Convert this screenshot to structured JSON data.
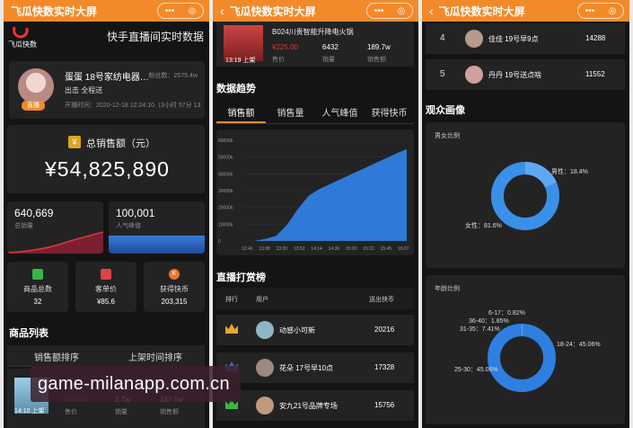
{
  "app": {
    "title": "飞瓜快数实时大屏"
  },
  "panel1": {
    "logo": "飞瓜快数",
    "heading": "快手直播间实时数据",
    "streamer": {
      "name": "蛋蛋 18号家纺电器…",
      "fans": "粉丝数：2575.4w",
      "tag": "出击 全程送",
      "start": "开播时间：2020-12-18 12:24:10（3小时 57分 13",
      "badge": "直播"
    },
    "gmv": {
      "label": "总销售额（元）",
      "value": "¥54,825,890",
      "icon": "yuan"
    },
    "sales": {
      "value": "640,669",
      "label": "总销量"
    },
    "popularity": {
      "value": "100,001",
      "label": "人气峰值"
    },
    "stats": [
      {
        "icon": "bag",
        "label": "商品总数",
        "value": "32"
      },
      {
        "icon": "tag",
        "label": "客单价",
        "value": "¥85.6"
      },
      {
        "icon": "coin",
        "label": "获得快币",
        "value": "203,315"
      }
    ],
    "products_title": "商品列表",
    "product_tabs": [
      "销售额排序",
      "上架时间排序"
    ],
    "product_row": {
      "time": "14:10 上架",
      "labels": [
        "售价",
        "销量",
        "销售额"
      ],
      "values": [
        "¥89.00",
        "2.7w",
        "237.1w"
      ]
    }
  },
  "panel2": {
    "product": {
      "name": "B024川贵智能升降电火锅",
      "time": "13:19 上架",
      "price": "¥225.00",
      "sales": "6432",
      "revenue": "189.7w",
      "labels": [
        "售价",
        "销量",
        "销售额"
      ]
    },
    "trend_title": "数据趋势",
    "trend_tabs": [
      "销售额",
      "销售量",
      "人气峰值",
      "获得快币"
    ],
    "chart_data": {
      "type": "area",
      "x": [
        "12:46",
        "13:08",
        "13:30",
        "13:52",
        "14:14",
        "14:36",
        "15:00",
        "15:22",
        "15:45",
        "16:07"
      ],
      "y_ticks": [
        "60000k",
        "50000k",
        "40000k",
        "30000k",
        "20000k",
        "10000k",
        "0"
      ],
      "ylim": [
        0,
        60000
      ],
      "points": [
        0,
        0,
        1200,
        3000,
        9500,
        19000,
        27000,
        31000,
        34000,
        37000,
        40000,
        43000,
        46000,
        49000,
        52000,
        54800
      ],
      "color": "#2f7fe0"
    },
    "ranking_title": "直播打赏榜",
    "ranking_headers": [
      "排行",
      "用户",
      "送出快币"
    ],
    "ranking": [
      {
        "rank": "1",
        "name": "动感小可新",
        "coins": "20216",
        "badge": "crown-gold"
      },
      {
        "rank": "2",
        "name": "花朵 17号早10点",
        "coins": "17328",
        "badge": "crown-silver"
      },
      {
        "rank": "3",
        "name": "安九21号品牌专场",
        "coins": "15756",
        "badge": "crown-bronze"
      }
    ]
  },
  "panel3": {
    "ranking": [
      {
        "rank": "4",
        "name": "佳佳 19号早9点",
        "coins": "14288"
      },
      {
        "rank": "5",
        "name": "丹丹 19号送点啥",
        "coins": "11552"
      }
    ],
    "audience_title": "观众画像",
    "gender": {
      "title": "男女比例",
      "male_label": "男性：18.4%",
      "female_label": "女性：81.6%",
      "male": 18.4,
      "female": 81.6
    },
    "age": {
      "title": "年龄比例",
      "labels": [
        "6-17：0.82%",
        "36-40：1.85%",
        "31-35：7.41%",
        "18-24：45.06%",
        "25-30：45.06%"
      ],
      "values": [
        0.82,
        1.85,
        7.41,
        45.06,
        45.06
      ]
    }
  },
  "watermark": "game-milanapp.com.cn",
  "colors": {
    "accent": "#f28a2a",
    "bar_blue": "#2f7fe0",
    "red": "#d83a3a",
    "card": "#232323"
  }
}
